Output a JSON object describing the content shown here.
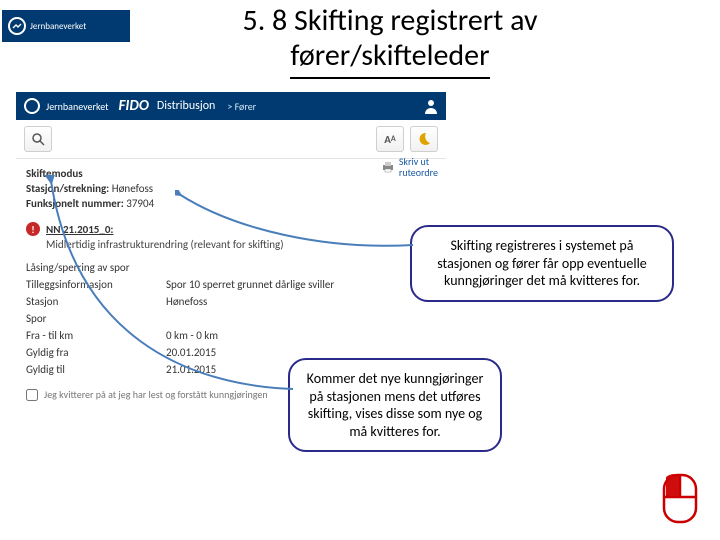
{
  "jbv_brand": "Jernbaneverket",
  "title_line1": "5. 8 Skifting registrert av",
  "title_line2": "fører/skifteleder",
  "topbar": {
    "brand_small": "Jernbaneverket",
    "fido": "FIDO",
    "dist": "Distribusjon",
    "crumb": ">  Fører"
  },
  "toolbar": {
    "aa": "AA"
  },
  "print": {
    "line1": "Skriv ut",
    "line2": "ruteordre"
  },
  "meta": {
    "mode_label": "Skiftemodus",
    "station_label": "Stasjon/strekning:",
    "station_value": "Hønefoss",
    "funcnum_label": "Funksjonelt nummer:",
    "funcnum_value": "37904"
  },
  "alert": {
    "code": "NN 21.2015_0:",
    "subtitle": "Midlertidig infrastrukturendring (relevant for skifting)"
  },
  "kv": {
    "k1": "Låsing/sperring av spor",
    "k2": "Tilleggsinformasjon",
    "v2": "Spor 10 sperret grunnet dårlige sviller",
    "k3": "Stasjon",
    "v3": "Hønefoss",
    "k4": "Spor",
    "k5": "Fra - til km",
    "v5": "0 km - 0 km",
    "k6": "Gyldig fra",
    "v6": "20.01.2015",
    "k7": "Gyldig til",
    "v7": "21.01.2015"
  },
  "ack_text": "Jeg kvitterer på at jeg har lest og forstått kunngjøringen",
  "callout1": "Skifting registreres i systemet på stasjonen og fører får opp eventuelle kunngjøringer det må kvitteres for.",
  "callout2": "Kommer det nye kunngjøringer på stasjonen mens det utføres skifting, vises disse som nye og må kvitteres for."
}
